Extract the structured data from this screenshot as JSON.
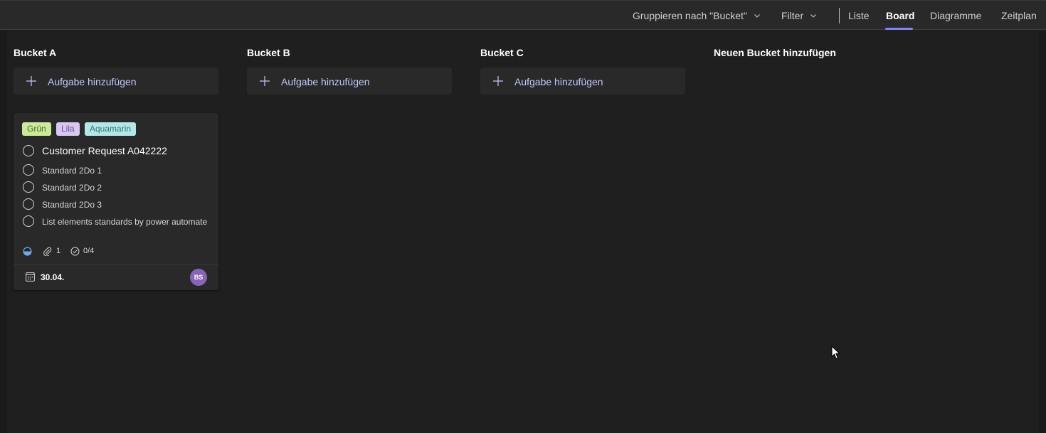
{
  "toolbar": {
    "group_by_label": "Gruppieren nach \"Bucket\"",
    "filter_label": "Filter",
    "views": [
      {
        "label": "Liste",
        "active": false
      },
      {
        "label": "Board",
        "active": true
      },
      {
        "label": "Diagramme",
        "active": false
      },
      {
        "label": "Zeitplan",
        "active": false
      }
    ],
    "accent_color": "#7f85f5"
  },
  "buckets": [
    {
      "title": "Bucket A",
      "add_task_label": "Aufgabe hinzufügen"
    },
    {
      "title": "Bucket B",
      "add_task_label": "Aufgabe hinzufügen"
    },
    {
      "title": "Bucket C",
      "add_task_label": "Aufgabe hinzufügen"
    }
  ],
  "new_bucket_label": "Neuen Bucket hinzufügen",
  "card": {
    "labels": [
      {
        "text": "Grün",
        "color": "#caea9c"
      },
      {
        "text": "Lila",
        "color": "#d8c7f0"
      },
      {
        "text": "Aquamarin",
        "color": "#b5e7e7"
      }
    ],
    "title": "Customer Request A042222",
    "checklist": [
      "Standard 2Do 1",
      "Standard 2Do 2",
      "Standard 2Do 3",
      "List elements standards by power automate"
    ],
    "progress_icon": "half-circle-progress-icon",
    "attachments_count": "1",
    "checklist_progress": "0/4",
    "due_date": "30.04.",
    "assignee_initials": "BS",
    "assignee_color": "#8764b8"
  }
}
